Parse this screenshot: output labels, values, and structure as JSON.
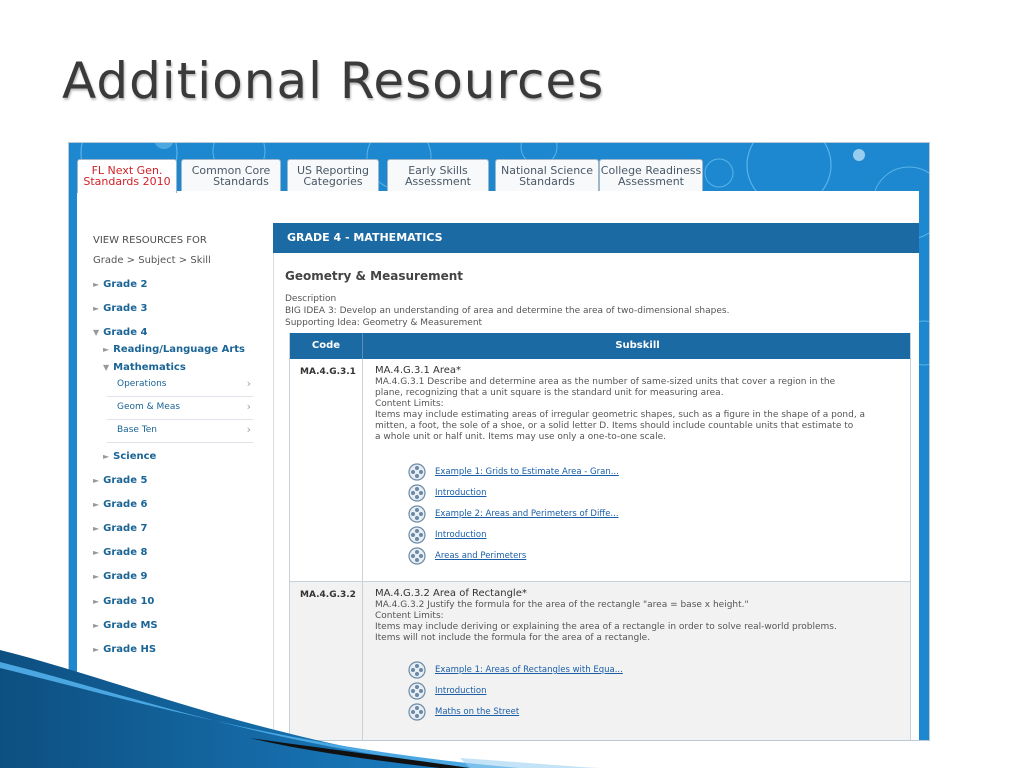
{
  "slide": {
    "title": "Additional Resources"
  },
  "tabs": [
    {
      "line1": "FL Next Gen.",
      "line2": "Standards 2010",
      "active": true
    },
    {
      "line1": "Common Core",
      "line2": "Standards",
      "active": false
    },
    {
      "line1": "US Reporting",
      "line2": "Categories",
      "active": false
    },
    {
      "line1": "Early Skills",
      "line2": "Assessment",
      "active": false
    },
    {
      "line1": "National Science",
      "line2": "Standards",
      "active": false
    },
    {
      "line1": "College Readiness",
      "line2": "Assessment",
      "active": false
    }
  ],
  "sidebar": {
    "heading": "VIEW RESOURCES FOR",
    "breadcrumb": "Grade > Subject > Skill",
    "grades_top": [
      "Grade 2",
      "Grade 3"
    ],
    "grade_open": "Grade 4",
    "subjects": [
      "Reading/Language Arts",
      "Mathematics"
    ],
    "skills": [
      "Operations",
      "Geom & Meas",
      "Base Ten"
    ],
    "subject_after": "Science",
    "grades_bottom": [
      "Grade 5",
      "Grade 6",
      "Grade 7",
      "Grade 8",
      "Grade 9",
      "Grade 10",
      "Grade MS",
      "Grade HS"
    ]
  },
  "main": {
    "bar_title": "GRADE 4 - MATHEMATICS",
    "section_title": "Geometry & Measurement",
    "description_label": "Description",
    "description_line1": "BIG IDEA 3: Develop an understanding of area and determine the area of two-dimensional shapes.",
    "description_line2": "Supporting Idea: Geometry & Measurement"
  },
  "table": {
    "headers": {
      "code": "Code",
      "subskill": "Subskill"
    },
    "rows": [
      {
        "code": "MA.4.G.3.1",
        "title": "MA.4.G.3.1 Area*",
        "lines": [
          "MA.4.G.3.1 Describe and determine area as the number of same-sized units that cover a region in the",
          "plane, recognizing that a unit square is the standard unit for measuring area.",
          "Content Limits:",
          "Items may include estimating areas of irregular geometric shapes, such as a figure in the shape of a pond, a",
          "mitten, a foot, the sole of a shoe, or a solid letter D. Items should include countable units that estimate to",
          "a whole unit or half unit. Items may use only a one-to-one scale."
        ],
        "links": [
          "Example 1: Grids to Estimate Area - Gran...",
          "Introduction",
          "Example 2: Areas and Perimeters of Diffe...",
          "Introduction",
          "Areas and Perimeters"
        ]
      },
      {
        "code": "MA.4.G.3.2",
        "title": "MA.4.G.3.2 Area of Rectangle*",
        "lines": [
          "MA.4.G.3.2 Justify the formula for the area of the rectangle \"area = base x height.\"",
          "Content Limits:",
          "Items may include deriving or explaining the area of a rectangle in order to solve real-world problems.",
          "Items will not include the formula for the area of a rectangle."
        ],
        "links": [
          "Example 1: Areas of Rectangles with Equa...",
          "Introduction",
          "Maths on the Street"
        ]
      }
    ]
  },
  "colors": {
    "header_blue": "#1b6aa3",
    "background_blue": "#1d88cf",
    "link_blue": "#1a5ea8",
    "active_tab_red": "#d12229"
  },
  "icons": {
    "link_icon": "film-reel-icon",
    "expand_icon": "chevron-right-icon",
    "tree_icon": "triangle-icon"
  }
}
